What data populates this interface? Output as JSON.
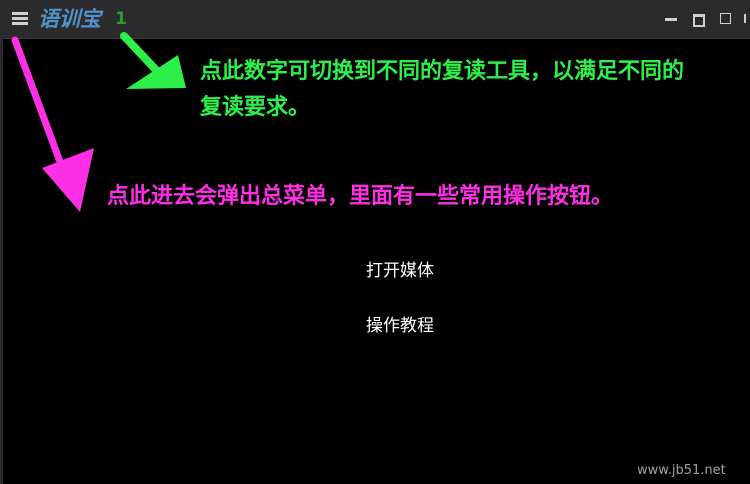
{
  "app": {
    "title": "语训宝",
    "mode_number": "1"
  },
  "window_controls": {
    "icons": [
      "minimize-icon",
      "restore-icon",
      "maximize-icon",
      "close-icon"
    ]
  },
  "annotations": {
    "green_line1": "点此数字可切换到不同的复读工具，以满足不同的",
    "green_line2": "复读要求。",
    "magenta": "点此进去会弹出总菜单，里面有一些常用操作按钮。",
    "colors": {
      "green": "#2ef04a",
      "magenta": "#ff2fe6"
    }
  },
  "menu": {
    "items": [
      {
        "label": "打开媒体"
      },
      {
        "label": "操作教程"
      }
    ]
  },
  "watermark": "www.jb51.net",
  "colors": {
    "title": "#4f93c8",
    "number": "#2aa02a",
    "background": "#000000",
    "titlebar": "#2b2b2d"
  }
}
